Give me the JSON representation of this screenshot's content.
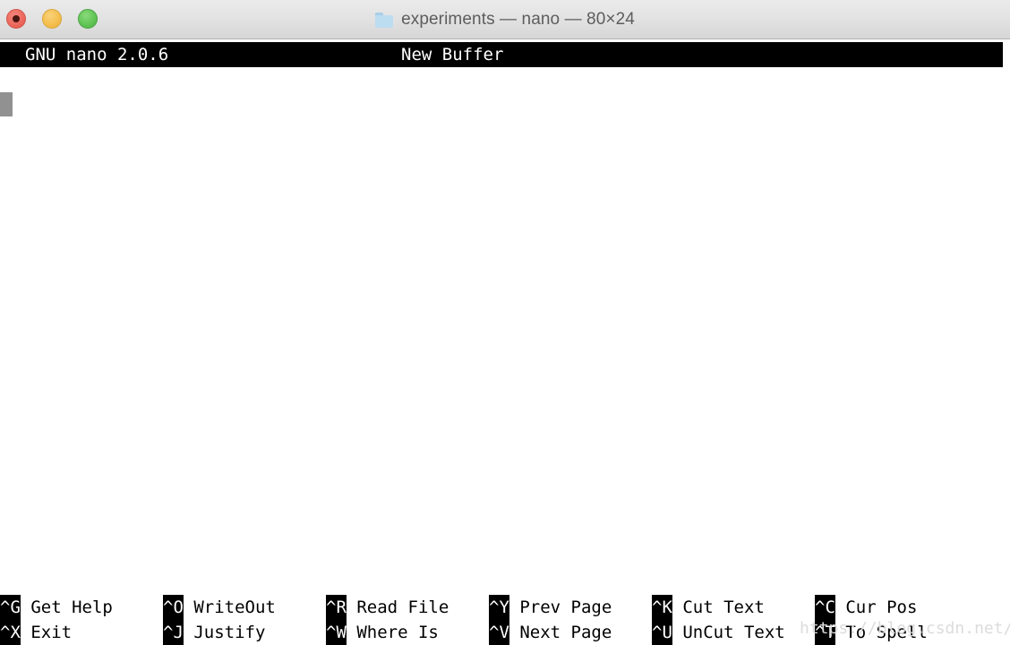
{
  "window": {
    "title": "experiments — nano — 80×24",
    "folder_icon": "folder-icon",
    "traffic_lights": [
      {
        "name": "close",
        "color": "#ed6a5e"
      },
      {
        "name": "minimize",
        "color": "#f5bf4f"
      },
      {
        "name": "maximize",
        "color": "#61c555"
      }
    ]
  },
  "terminal": {
    "cols": 80,
    "rows": 24,
    "nano_titlebar": {
      "version": "GNU nano 2.0.6",
      "buffer": "New Buffer"
    },
    "buffer": {
      "lines": [],
      "cursor": {
        "row": 0,
        "col": 0
      }
    },
    "help": {
      "row1": [
        {
          "key": "^G",
          "label": "Get Help"
        },
        {
          "key": "^O",
          "label": "WriteOut"
        },
        {
          "key": "^R",
          "label": "Read File"
        },
        {
          "key": "^Y",
          "label": "Prev Page"
        },
        {
          "key": "^K",
          "label": "Cut Text"
        },
        {
          "key": "^C",
          "label": "Cur Pos"
        }
      ],
      "row2": [
        {
          "key": "^X",
          "label": "Exit"
        },
        {
          "key": "^J",
          "label": "Justify"
        },
        {
          "key": "^W",
          "label": "Where Is"
        },
        {
          "key": "^V",
          "label": "Next Page"
        },
        {
          "key": "^U",
          "label": "UnCut Text"
        },
        {
          "key": "^T",
          "label": "To Spell"
        }
      ]
    }
  },
  "watermark": {
    "text": "https://blog.csdn.net/Robin_Pi"
  }
}
